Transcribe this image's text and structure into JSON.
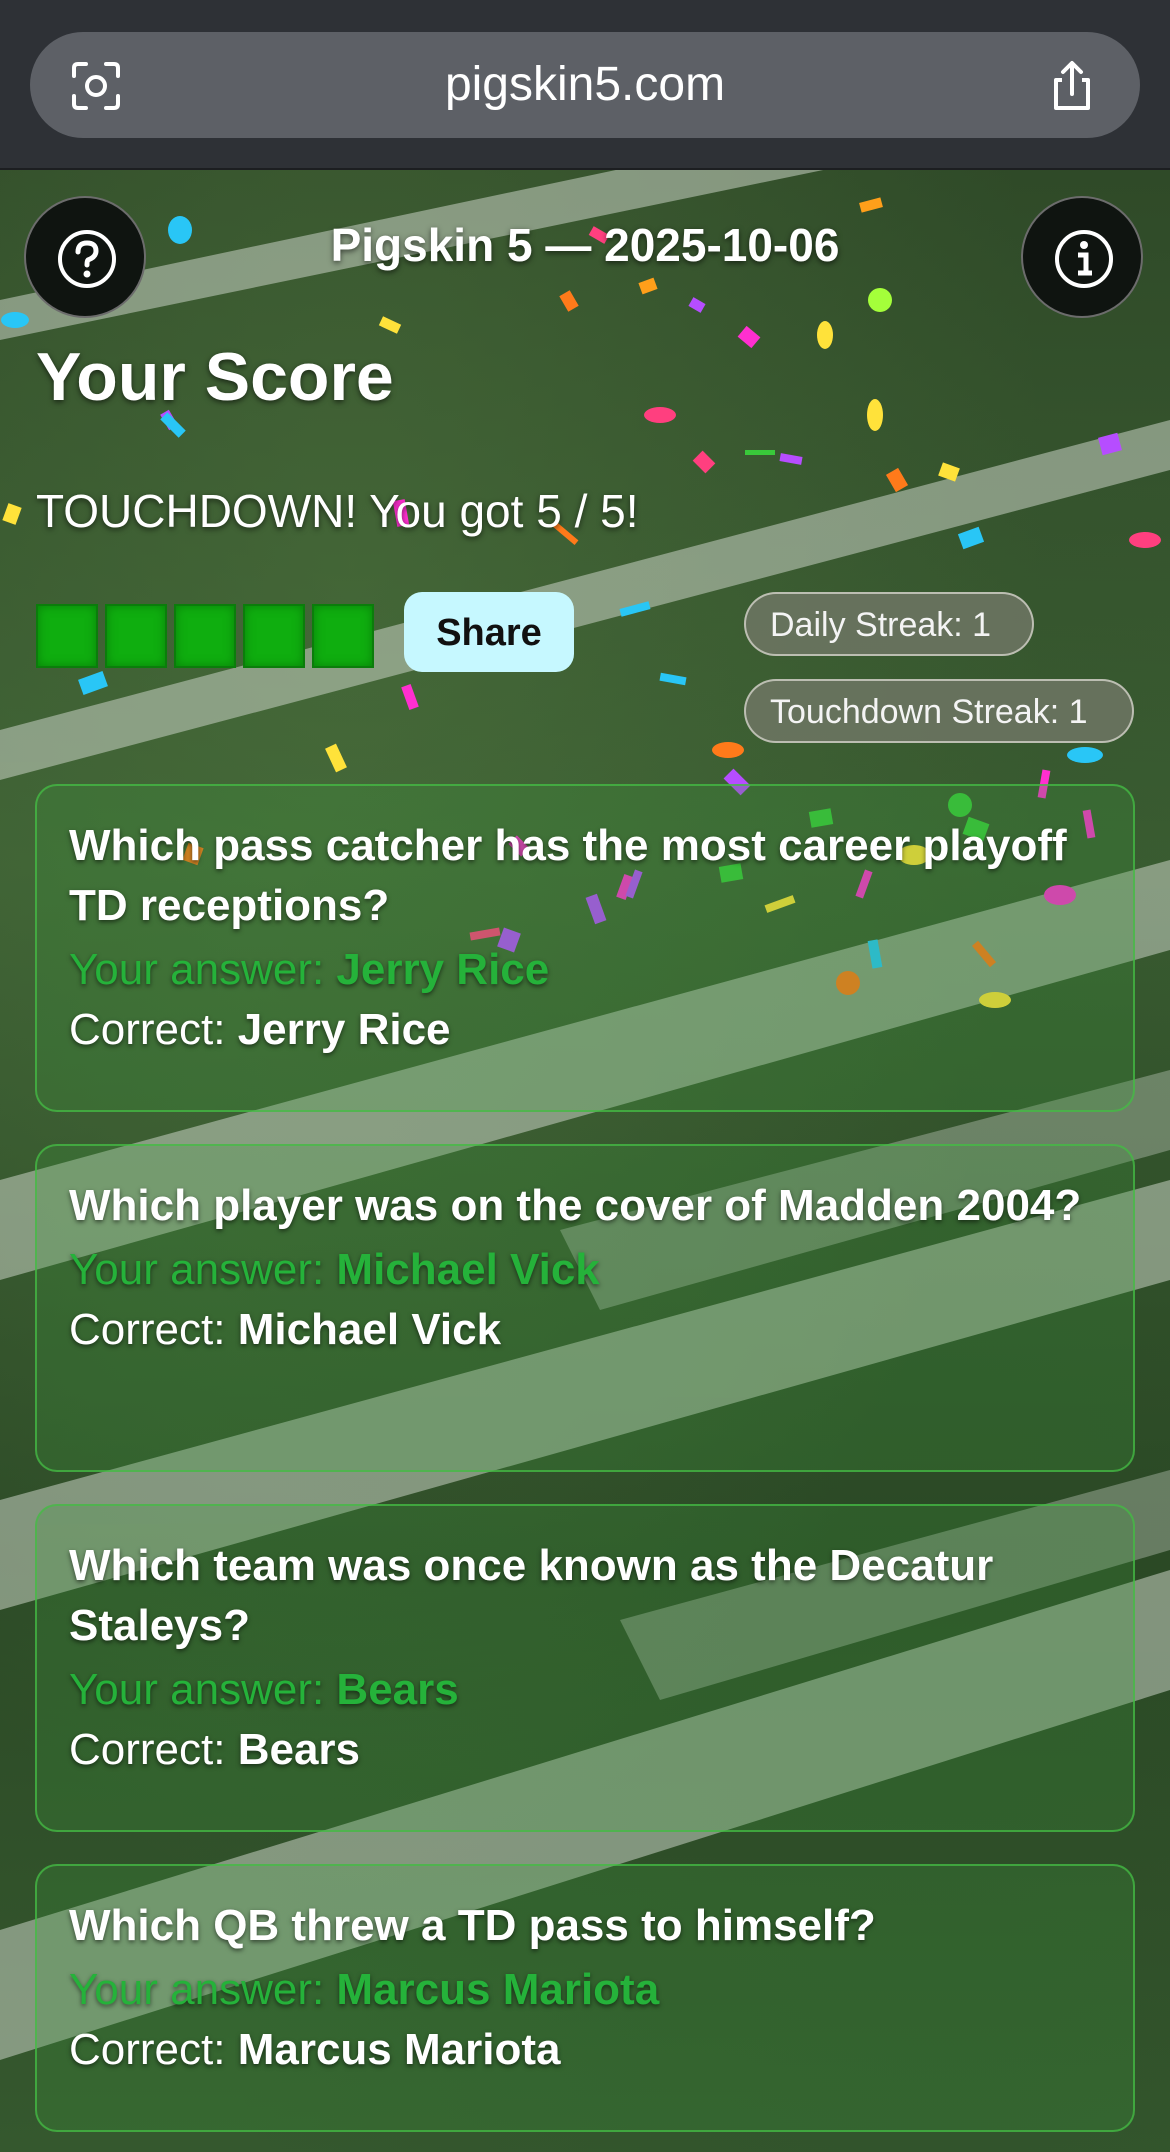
{
  "browser": {
    "url": "pigskin5.com"
  },
  "header": {
    "title": "Pigskin 5 — 2025-10-06",
    "help_icon": "question-circle-icon",
    "info_icon": "info-circle-icon"
  },
  "score": {
    "heading": "Your Score",
    "result": "TOUCHDOWN! You got 5 / 5!",
    "correct": 5,
    "total": 5,
    "share_label": "Share",
    "daily_streak": "Daily Streak: 1",
    "touchdown_streak": "Touchdown Streak: 1"
  },
  "labels": {
    "your_answer": "Your answer: ",
    "correct": "Correct: "
  },
  "questions": [
    {
      "question": "Which pass catcher has the most career playoff TD receptions?",
      "your_answer": "Jerry Rice",
      "correct": "Jerry Rice"
    },
    {
      "question": "Which player was on the cover of Madden 2004?",
      "your_answer": "Michael Vick",
      "correct": "Michael Vick"
    },
    {
      "question": "Which team was once known as the Decatur Staleys?",
      "your_answer": "Bears",
      "correct": "Bears"
    },
    {
      "question": "Which QB threw a TD pass to himself?",
      "your_answer": "Marcus Mariota",
      "correct": "Marcus Mariota"
    }
  ],
  "colors": {
    "correct_green": "#25b23a",
    "square_green": "#0fae0f",
    "share_bg": "#c6f8ff"
  }
}
